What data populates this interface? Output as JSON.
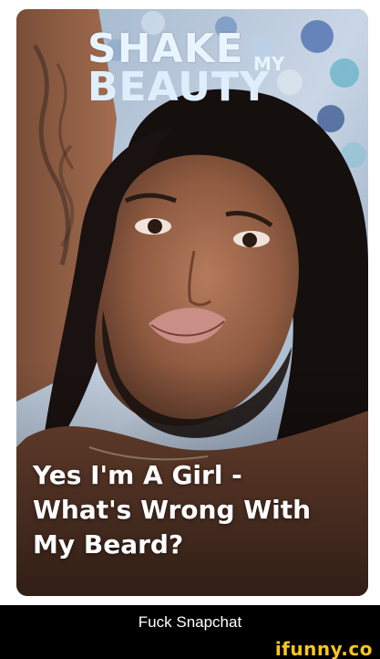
{
  "story": {
    "masthead": {
      "line1": "SHAKE",
      "small": "MY",
      "line2": "BEAUTY"
    },
    "headline_lines": [
      "Yes I'm A Girl -",
      "What's Wrong With",
      "My Beard?"
    ]
  },
  "caption": {
    "text": "Fuck Snapchat"
  },
  "watermark": {
    "text": "ifunny.co"
  },
  "colors": {
    "caption_bar": "#000000",
    "watermark": "#f7c51e",
    "headline": "#ffffff"
  }
}
